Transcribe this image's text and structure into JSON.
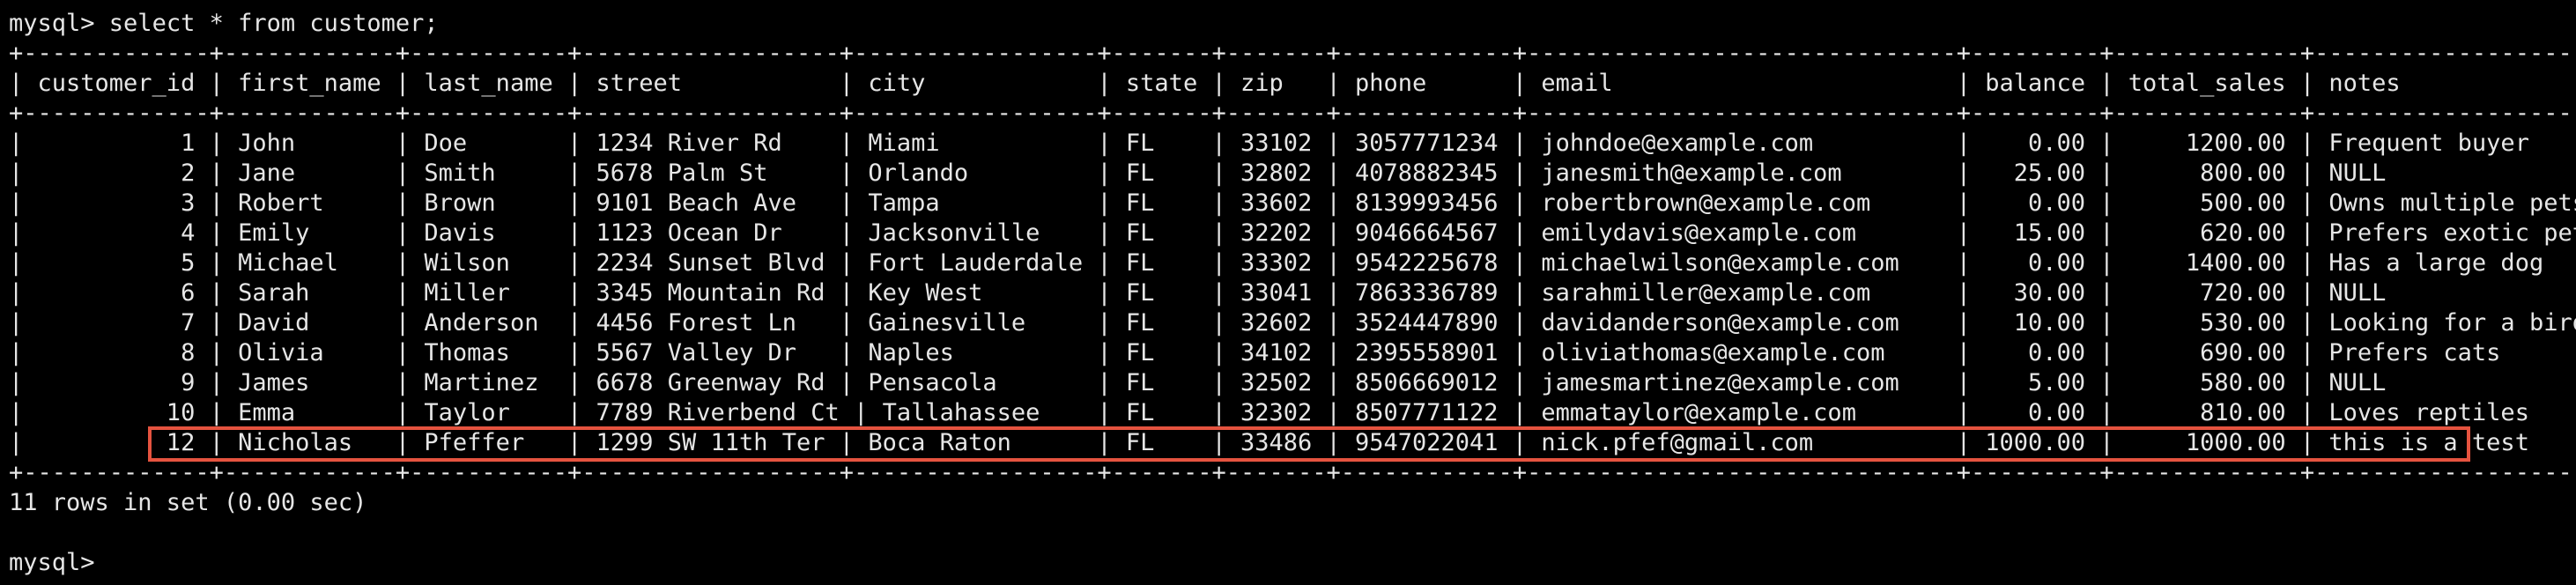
{
  "terminal": {
    "prompt": "mysql> ",
    "command": "select * from customer;",
    "border_line": "+-------------+------------+-----------+------------------+-----------------+-------+-------+------------+------------------------------+---------+-------------+----------------------+",
    "header_line": "| customer_id | first_name | last_name | street           | city            | state | zip   | phone      | email                        | balance | total_sales | notes                |",
    "rows": [
      "|           1 | John       | Doe       | 1234 River Rd    | Miami           | FL    | 33102 | 3057771234 | johndoe@example.com          |    0.00 |     1200.00 | Frequent buyer       |",
      "|           2 | Jane       | Smith     | 5678 Palm St     | Orlando         | FL    | 32802 | 4078882345 | janesmith@example.com        |   25.00 |      800.00 | NULL                 |",
      "|           3 | Robert     | Brown     | 9101 Beach Ave   | Tampa           | FL    | 33602 | 8139993456 | robertbrown@example.com      |    0.00 |      500.00 | Owns multiple pets   |",
      "|           4 | Emily      | Davis     | 1123 Ocean Dr    | Jacksonville    | FL    | 32202 | 9046664567 | emilydavis@example.com       |   15.00 |      620.00 | Prefers exotic pets  |",
      "|           5 | Michael    | Wilson    | 2234 Sunset Blvd | Fort Lauderdale | FL    | 33302 | 9542225678 | michaelwilson@example.com    |    0.00 |     1400.00 | Has a large dog      |",
      "|           6 | Sarah      | Miller    | 3345 Mountain Rd | Key West        | FL    | 33041 | 7863336789 | sarahmiller@example.com      |   30.00 |      720.00 | NULL                 |",
      "|           7 | David      | Anderson  | 4456 Forest Ln   | Gainesville     | FL    | 32602 | 3524447890 | davidanderson@example.com    |   10.00 |      530.00 | Looking for a bird   |",
      "|           8 | Olivia     | Thomas    | 5567 Valley Dr   | Naples          | FL    | 34102 | 2395558901 | oliviathomas@example.com     |    0.00 |      690.00 | Prefers cats         |",
      "|           9 | James      | Martinez  | 6678 Greenway Rd | Pensacola       | FL    | 32502 | 8506669012 | jamesmartinez@example.com    |    5.00 |      580.00 | NULL                 |",
      "|          10 | Emma       | Taylor    | 7789 Riverbend Ct | Tallahassee    | FL    | 32302 | 8507771122 | emmataylor@example.com       |    0.00 |      810.00 | Loves reptiles       |",
      "|          12 | Nicholas   | Pfeffer   | 1299 SW 11th Ter | Boca Raton      | FL    | 33486 | 9547022041 | nick.pfef@gmail.com          | 1000.00 |     1000.00 | this is a test       |"
    ],
    "result_summary": "11 rows in set (0.00 sec)",
    "final_prompt": "mysql>",
    "colors": {
      "background": "#000000",
      "text": "#e6e6e6",
      "highlight_border": "#e5533f"
    }
  }
}
